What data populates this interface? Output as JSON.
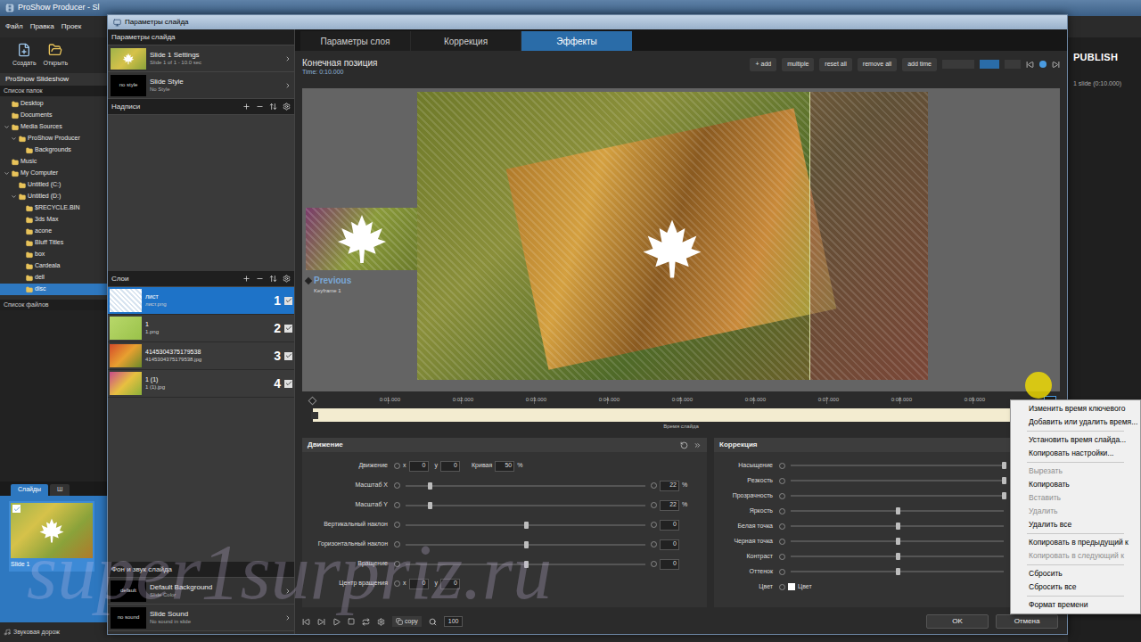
{
  "main_window": {
    "title": "ProShow Producer - Sl",
    "menu": [
      "Файл",
      "Правка",
      "Проек"
    ],
    "toolbar": [
      {
        "label": "Создать"
      },
      {
        "label": "Открыть"
      }
    ],
    "project_title": "ProShow Slideshow",
    "folders_header": "Список папок",
    "folders": [
      {
        "name": "Desktop",
        "expanded": false,
        "selected": false,
        "children": []
      },
      {
        "name": "Documents",
        "expanded": false,
        "selected": false,
        "children": []
      },
      {
        "name": "Media Sources",
        "expanded": true,
        "selected": false,
        "children": [
          {
            "name": "ProShow Producer",
            "expanded": true,
            "selected": false,
            "children": [
              {
                "name": "Backgrounds",
                "expanded": false,
                "selected": false,
                "children": []
              }
            ]
          }
        ]
      },
      {
        "name": "Music",
        "expanded": false,
        "selected": false,
        "children": []
      },
      {
        "name": "My Computer",
        "expanded": true,
        "selected": false,
        "children": [
          {
            "name": "Untitled (C:)",
            "expanded": false,
            "selected": false,
            "children": []
          },
          {
            "name": "Untitled (D:)",
            "expanded": true,
            "selected": false,
            "children": [
              {
                "name": "$RECYCLE.BIN",
                "expanded": false,
                "selected": false,
                "children": []
              },
              {
                "name": "3ds Max",
                "expanded": false,
                "selected": false,
                "children": []
              },
              {
                "name": "acone",
                "expanded": false,
                "selected": false,
                "children": []
              },
              {
                "name": "Bluff Titles",
                "expanded": false,
                "selected": false,
                "children": []
              },
              {
                "name": "box",
                "expanded": false,
                "selected": false,
                "children": []
              },
              {
                "name": "Cardeala",
                "expanded": false,
                "selected": false,
                "children": []
              },
              {
                "name": "dell",
                "expanded": false,
                "selected": false,
                "children": []
              },
              {
                "name": "disc",
                "expanded": false,
                "selected": true,
                "children": []
              }
            ]
          }
        ]
      }
    ],
    "files_header": "Список файлов",
    "slide_tabs": [
      {
        "label": "Слайды",
        "selected": true
      },
      {
        "label": "Ш",
        "selected": false
      }
    ],
    "slides": [
      {
        "label": "Slide 1",
        "checked": true,
        "selected": true
      }
    ],
    "soundtrack": "Звуковая дорож",
    "publish": "PUBLISH",
    "summary": "1 slide (0:10.000)"
  },
  "dialog": {
    "title": "Параметры слайда",
    "side_header": "Параметры слайда",
    "slide_settings": {
      "title": "Slide 1 Settings",
      "sub": "Slide 1 of 1 - 10.0 sec"
    },
    "slide_style": {
      "badge": "no style",
      "title": "Slide Style",
      "sub": "No Style"
    },
    "captions_header": "Надписи",
    "layers_header": "Слои",
    "layers": [
      {
        "name": "лист",
        "file": "лист.png",
        "number": "1",
        "selected": true,
        "checked": true
      },
      {
        "name": "1",
        "file": "1.png",
        "number": "2",
        "selected": false,
        "checked": true
      },
      {
        "name": "4145304375179538",
        "file": "4145304375179538.jpg",
        "number": "3",
        "selected": false,
        "checked": true
      },
      {
        "name": "1 (1)",
        "file": "1 (1).jpg",
        "number": "4",
        "selected": false,
        "checked": true
      }
    ],
    "background_header": "Фон и звук слайда",
    "background": {
      "badge": "default",
      "title": "Default Background",
      "sub": "Slide Color"
    },
    "sound": {
      "badge": "no sound",
      "title": "Slide Sound",
      "sub": "No sound in slide"
    },
    "tabs": [
      {
        "label": "Параметры слоя",
        "selected": false
      },
      {
        "label": "Коррекция",
        "selected": false
      },
      {
        "label": "Эффекты",
        "selected": true
      }
    ],
    "keyframe": {
      "title": "Конечная позиция",
      "time": "Time: 0:10.000"
    },
    "keyframe_buttons": [
      "+ add",
      "multiple",
      "reset all",
      "remove all",
      "add time"
    ],
    "previous": {
      "label": "Previous",
      "sub": "Keyframe 1"
    },
    "timeline": {
      "ticks": [
        "0:01.000",
        "0:02.000",
        "0:03.000",
        "0:04.000",
        "0:05.000",
        "0:06.000",
        "0:07.000",
        "0:08.000",
        "0:09.000"
      ],
      "label": "Время слайда"
    },
    "motion": {
      "title": "Движение",
      "rows": [
        {
          "kind": "xy",
          "label": "Движение",
          "x_label": "x",
          "x": "0",
          "y_label": "y",
          "y": "0",
          "extra_label": "Кривая",
          "extra_value": "50",
          "unit": "%"
        },
        {
          "kind": "slider",
          "label": "Масштаб X",
          "value": "22",
          "unit": "%",
          "level": 0.1
        },
        {
          "kind": "slider",
          "label": "Масштаб Y",
          "value": "22",
          "unit": "%",
          "level": 0.1
        },
        {
          "kind": "slider",
          "label": "Вертикальный наклон",
          "value": "0",
          "unit": "",
          "level": 0.5
        },
        {
          "kind": "slider",
          "label": "Горизонтальный наклон",
          "value": "0",
          "unit": "",
          "level": 0.5
        },
        {
          "kind": "slider",
          "label": "Вращение",
          "value": "0",
          "unit": "",
          "level": 0.5
        },
        {
          "kind": "xy",
          "label": "Центр вращения",
          "x_label": "x",
          "x": "0",
          "y_label": "y",
          "y": "0",
          "extra_label": "",
          "extra_value": "",
          "unit": ""
        }
      ]
    },
    "correction": {
      "title": "Коррекция",
      "rows": [
        {
          "kind": "slider",
          "label": "Насыщение",
          "level": 1
        },
        {
          "kind": "slider",
          "label": "Резкость",
          "level": 1
        },
        {
          "kind": "slider",
          "label": "Прозрачность",
          "level": 1
        },
        {
          "kind": "slider",
          "label": "Яркость",
          "level": 0.5
        },
        {
          "kind": "slider",
          "label": "Белая точка",
          "level": 0.5
        },
        {
          "kind": "slider",
          "label": "Черная точка",
          "level": 0.5
        },
        {
          "kind": "slider",
          "label": "Контраст",
          "level": 0.5
        },
        {
          "kind": "slider",
          "label": "Оттенок",
          "level": 0.5
        },
        {
          "kind": "color",
          "label": "Цвет",
          "swatch_label": "Цвет",
          "level": 0
        }
      ]
    },
    "bottom_bar": {
      "copy": "copy",
      "zoom": "100"
    },
    "buttons": [
      "OK",
      "Отмена"
    ]
  },
  "context_menu": {
    "groups": [
      [
        {
          "label": "Изменить время ключевого",
          "disabled": false
        },
        {
          "label": "Добавить или удалить время...",
          "disabled": false
        }
      ],
      [
        {
          "label": "Установить время слайда...",
          "disabled": false
        },
        {
          "label": "Копировать настройки...",
          "disabled": false
        }
      ],
      [
        {
          "label": "Вырезать",
          "disabled": true
        },
        {
          "label": "Копировать",
          "disabled": false
        },
        {
          "label": "Вставить",
          "disabled": true
        },
        {
          "label": "Удалить",
          "disabled": true
        },
        {
          "label": "Удалить все",
          "disabled": false
        }
      ],
      [
        {
          "label": "Копировать в предыдущий к",
          "disabled": false
        },
        {
          "label": "Копировать в следующий к",
          "disabled": true
        }
      ],
      [
        {
          "label": "Сбросить",
          "disabled": false
        },
        {
          "label": "Сбросить все",
          "disabled": false
        }
      ],
      [
        {
          "label": "Формат времени",
          "disabled": false
        }
      ]
    ]
  },
  "watermark": "super1surpriz.ru"
}
